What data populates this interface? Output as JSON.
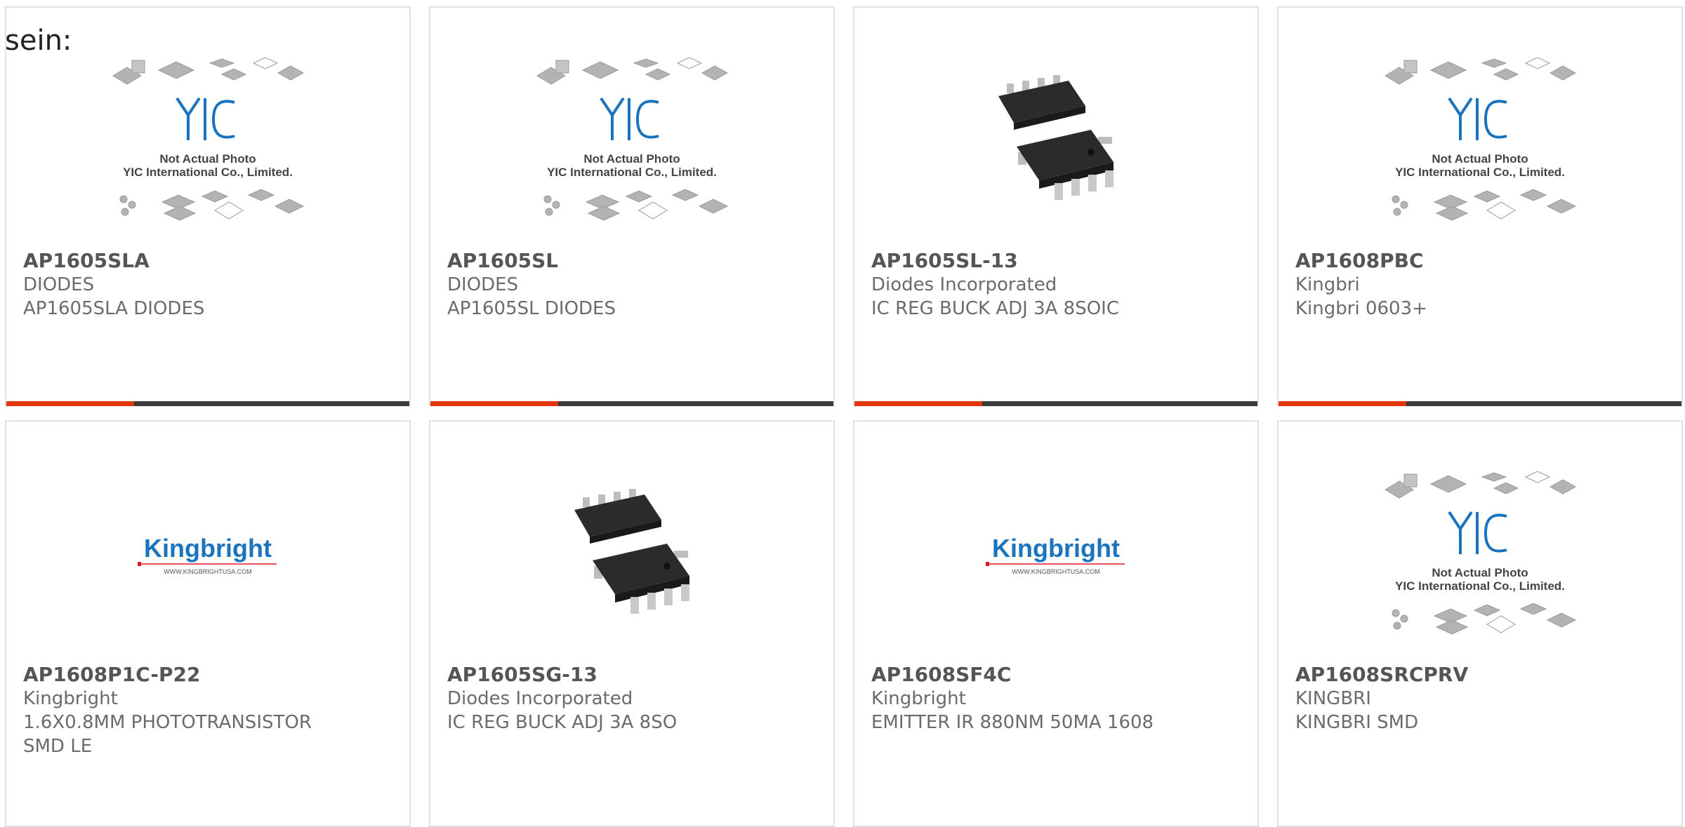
{
  "intro": "sein:",
  "placeholder": {
    "line1": "Not Actual Photo",
    "line2": "YIC International Co., Limited."
  },
  "kingbright_logo": {
    "brand": "Kingbright",
    "url": "WWW.KINGBRIGHTUSA.COM"
  },
  "accent_colors": {
    "bar_accent": "#e2360a",
    "bar_dark": "#3b3b3b",
    "chip": "#2b2b2b"
  },
  "products": [
    {
      "part": "AP1605SLA",
      "manufacturer": "DIODES",
      "description": "AP1605SLA DIODES",
      "image": "placeholder"
    },
    {
      "part": "AP1605SL",
      "manufacturer": "DIODES",
      "description": "AP1605SL DIODES",
      "image": "placeholder"
    },
    {
      "part": "AP1605SL-13",
      "manufacturer": "Diodes Incorporated",
      "description": "IC REG BUCK ADJ 3A 8SOIC",
      "image": "chip"
    },
    {
      "part": "AP1608PBC",
      "manufacturer": "Kingbri",
      "description": "Kingbri 0603+",
      "image": "placeholder"
    },
    {
      "part": "AP1608P1C-P22",
      "manufacturer": "Kingbright",
      "description": "1.6X0.8MM PHOTOTRANSISTOR SMD LE",
      "image": "kingbright"
    },
    {
      "part": "AP1605SG-13",
      "manufacturer": "Diodes Incorporated",
      "description": "IC REG BUCK ADJ 3A 8SO",
      "image": "chip"
    },
    {
      "part": "AP1608SF4C",
      "manufacturer": "Kingbright",
      "description": "EMITTER IR 880NM 50MA 1608",
      "image": "kingbright"
    },
    {
      "part": "AP1608SRCPRV",
      "manufacturer": "KINGBRI",
      "description": "KINGBRI SMD",
      "image": "placeholder"
    }
  ]
}
